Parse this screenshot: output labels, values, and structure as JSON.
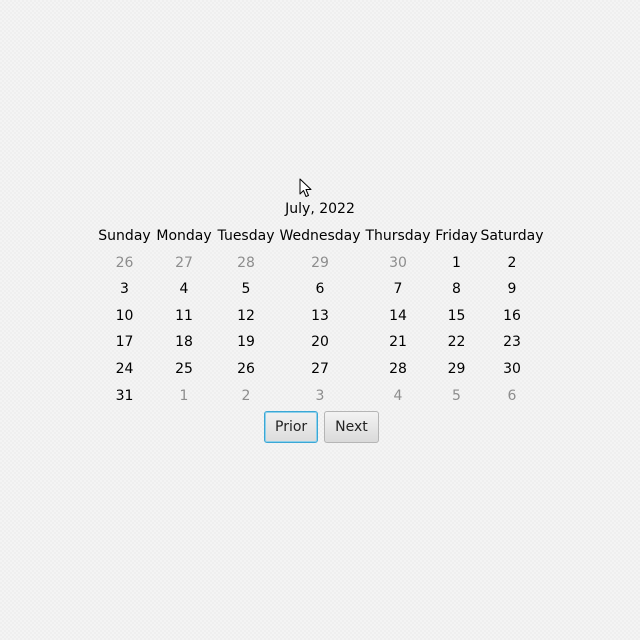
{
  "calendar": {
    "month_title": "July, 2022",
    "weekdays": [
      "Sunday",
      "Monday",
      "Tuesday",
      "Wednesday",
      "Thursday",
      "Friday",
      "Saturday"
    ],
    "weeks": [
      [
        {
          "day": "26",
          "in_month": false
        },
        {
          "day": "27",
          "in_month": false
        },
        {
          "day": "28",
          "in_month": false
        },
        {
          "day": "29",
          "in_month": false
        },
        {
          "day": "30",
          "in_month": false
        },
        {
          "day": "1",
          "in_month": true
        },
        {
          "day": "2",
          "in_month": true
        }
      ],
      [
        {
          "day": "3",
          "in_month": true
        },
        {
          "day": "4",
          "in_month": true
        },
        {
          "day": "5",
          "in_month": true
        },
        {
          "day": "6",
          "in_month": true
        },
        {
          "day": "7",
          "in_month": true
        },
        {
          "day": "8",
          "in_month": true
        },
        {
          "day": "9",
          "in_month": true
        }
      ],
      [
        {
          "day": "10",
          "in_month": true
        },
        {
          "day": "11",
          "in_month": true
        },
        {
          "day": "12",
          "in_month": true
        },
        {
          "day": "13",
          "in_month": true
        },
        {
          "day": "14",
          "in_month": true
        },
        {
          "day": "15",
          "in_month": true
        },
        {
          "day": "16",
          "in_month": true
        }
      ],
      [
        {
          "day": "17",
          "in_month": true
        },
        {
          "day": "18",
          "in_month": true
        },
        {
          "day": "19",
          "in_month": true
        },
        {
          "day": "20",
          "in_month": true
        },
        {
          "day": "21",
          "in_month": true
        },
        {
          "day": "22",
          "in_month": true
        },
        {
          "day": "23",
          "in_month": true
        }
      ],
      [
        {
          "day": "24",
          "in_month": true
        },
        {
          "day": "25",
          "in_month": true
        },
        {
          "day": "26",
          "in_month": true
        },
        {
          "day": "27",
          "in_month": true
        },
        {
          "day": "28",
          "in_month": true
        },
        {
          "day": "29",
          "in_month": true
        },
        {
          "day": "30",
          "in_month": true
        }
      ],
      [
        {
          "day": "31",
          "in_month": true
        },
        {
          "day": "1",
          "in_month": false
        },
        {
          "day": "2",
          "in_month": false
        },
        {
          "day": "3",
          "in_month": false
        },
        {
          "day": "4",
          "in_month": false
        },
        {
          "day": "5",
          "in_month": false
        },
        {
          "day": "6",
          "in_month": false
        }
      ]
    ]
  },
  "navigation": {
    "prior_label": "Prior",
    "next_label": "Next",
    "focused": "prior"
  },
  "colors": {
    "in_month_text": "#000000",
    "other_month_text": "#8d8d8d",
    "focus_ring": "#3aa7d5"
  },
  "icons": {
    "cursor": "mouse-pointer-icon"
  }
}
